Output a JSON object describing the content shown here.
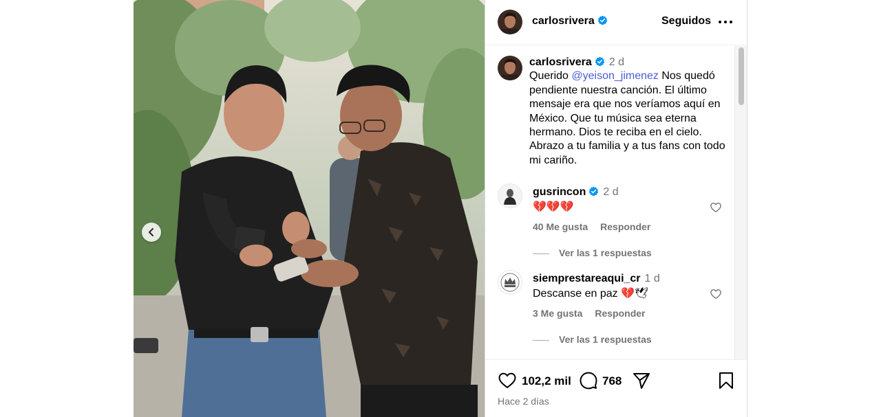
{
  "post": {
    "image_alt": "Two men looking at their phones outdoors",
    "prev_icon": "chevron-left-icon"
  },
  "header": {
    "username": "carlosrivera",
    "verified": true,
    "follow_label": "Seguidos",
    "more_icon": "more-horizontal-icon"
  },
  "caption": {
    "username": "carlosrivera",
    "time": "2 d",
    "text_before": "Querido ",
    "mention": "@yeison_jimenez",
    "text_after": " Nos quedó pendiente nuestra canción. El último mensaje era que nos veríamos aquí en México. Que tu música sea eterna hermano. Dios te reciba en el cielo. Abrazo a tu familia y a tus fans con todo mi cariño."
  },
  "comments": [
    {
      "username": "gusrincon",
      "verified": true,
      "time": "2 d",
      "text": "💔💔💔",
      "likes": "40 Me gusta",
      "reply_label": "Responder",
      "view_replies": "Ver las 1 respuestas"
    },
    {
      "username": "siemprestareaqui_cr",
      "verified": false,
      "time": "1 d",
      "text": "Descanse en paz 💔🕊",
      "likes": "3 Me gusta",
      "reply_label": "Responder",
      "view_replies": "Ver las 1 respuestas"
    }
  ],
  "actions": {
    "likes_count": "102,2 mil",
    "comments_count": "768",
    "posted_ago": "Hace 2 días"
  },
  "colors": {
    "verified_badge": "#0095f6",
    "mention": "#4b5bd6",
    "muted_text": "#737373",
    "border": "#dbdbdb"
  }
}
